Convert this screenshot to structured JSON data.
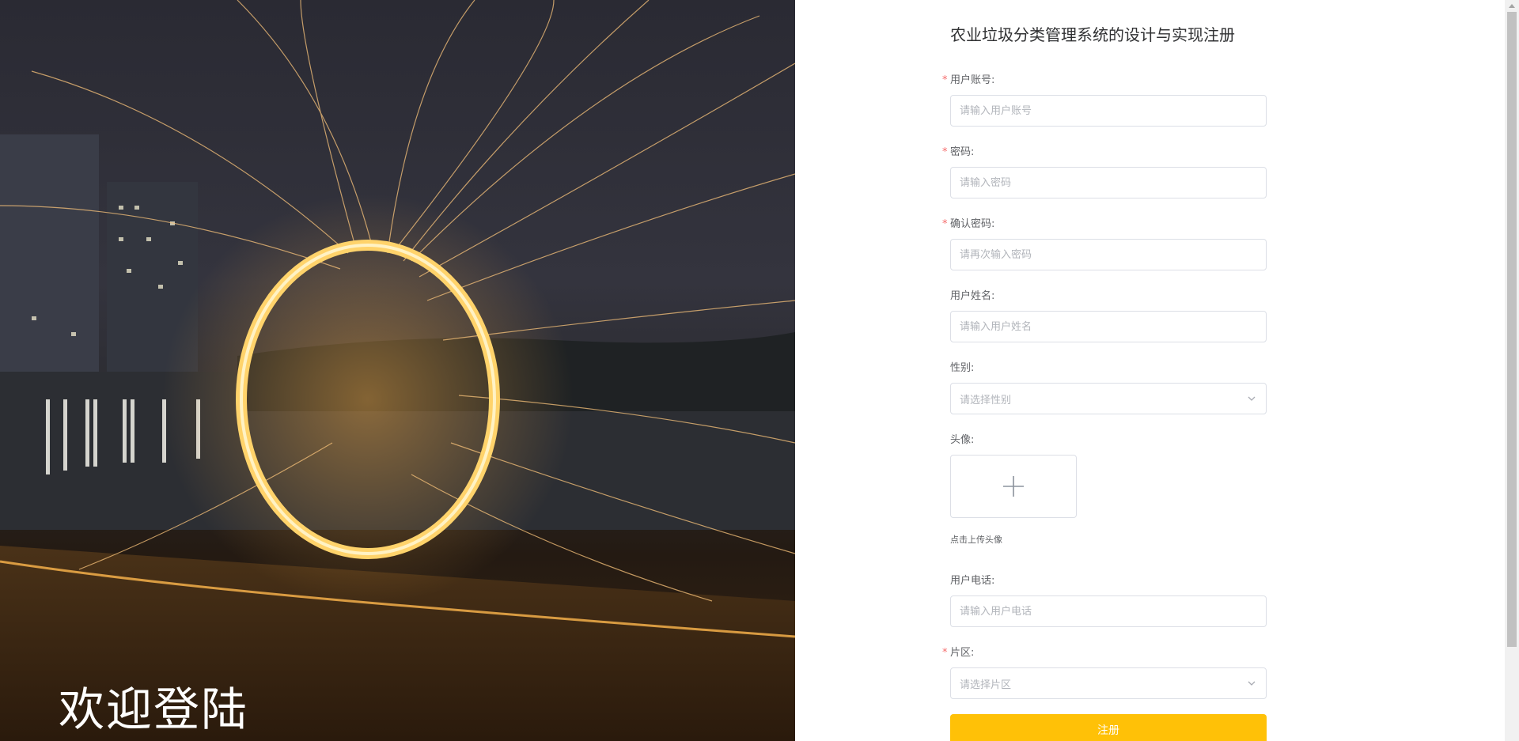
{
  "hero": {
    "title": "欢迎登陆"
  },
  "form": {
    "title": "农业垃圾分类管理系统的设计与实现注册",
    "fields": {
      "account": {
        "label": "用户账号:",
        "placeholder": "请输入用户账号",
        "required": true
      },
      "password": {
        "label": "密码:",
        "placeholder": "请输入密码",
        "required": true
      },
      "confirm_password": {
        "label": "确认密码:",
        "placeholder": "请再次输入密码",
        "required": true
      },
      "name": {
        "label": "用户姓名:",
        "placeholder": "请输入用户姓名",
        "required": false
      },
      "gender": {
        "label": "性别:",
        "placeholder": "请选择性别",
        "required": false
      },
      "avatar": {
        "label": "头像:",
        "hint": "点击上传头像",
        "required": false
      },
      "phone": {
        "label": "用户电话:",
        "placeholder": "请输入用户电话",
        "required": false
      },
      "district": {
        "label": "片区:",
        "placeholder": "请选择片区",
        "required": true
      }
    },
    "required_mark": "*",
    "submit_label": "注册"
  },
  "colors": {
    "accent": "#ffc107",
    "required": "#f56c6c",
    "border": "#dcdfe6",
    "placeholder": "#b2b5bb",
    "label": "#606266"
  },
  "icons": {
    "upload": "plus-icon",
    "select": "chevron-down-icon"
  }
}
